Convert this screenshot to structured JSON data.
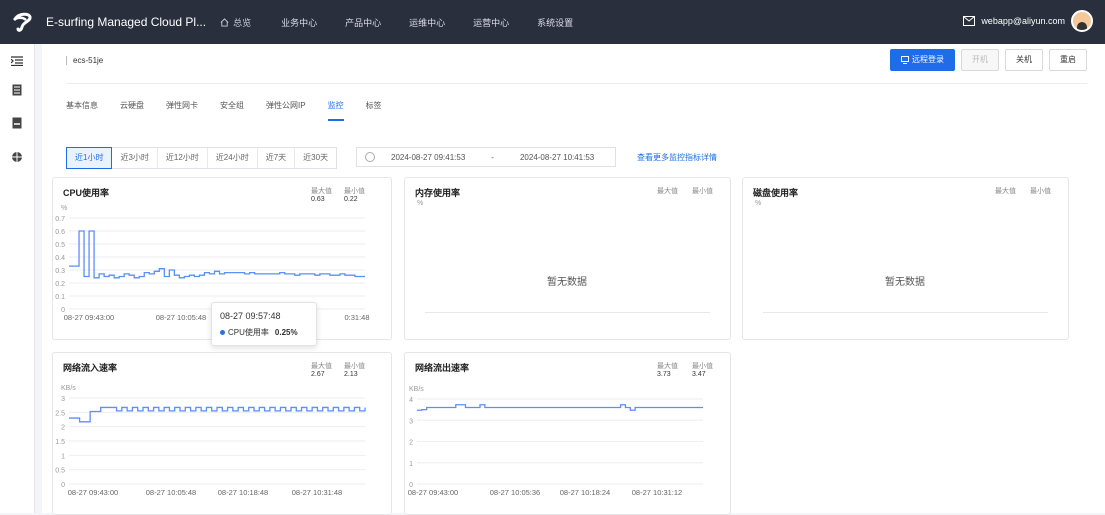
{
  "topbar": {
    "app_title": "E-surfing Managed Cloud Pl...",
    "home_label": "总览",
    "nav": [
      "业务中心",
      "产品中心",
      "运维中心",
      "运营中心",
      "系统设置"
    ],
    "user_email": "webapp@aliyun.com"
  },
  "instance": {
    "name": "ecs-51je",
    "actions": {
      "remote": "远程登录",
      "start": "开机",
      "stop": "关机",
      "restart": "重启"
    }
  },
  "tabs": [
    "基本信息",
    "云硬盘",
    "弹性网卡",
    "安全组",
    "弹性公网IP",
    "监控",
    "标签"
  ],
  "active_tab": "监控",
  "ranges": [
    "近1小时",
    "近3小时",
    "近12小时",
    "近24小时",
    "近7天",
    "近30天"
  ],
  "active_range": "近1小时",
  "time_start": "2024-08-27 09:41:53",
  "time_sep": "-",
  "time_end": "2024-08-27 10:41:53",
  "more_link": "查看更多监控指标详情",
  "labels": {
    "max": "最大值",
    "min": "最小值",
    "no_data": "暂无数据"
  },
  "cards": {
    "cpu": {
      "title": "CPU使用率",
      "unit": "%",
      "max": "0.63",
      "min": "0.22"
    },
    "mem": {
      "title": "内存使用率",
      "unit": "%"
    },
    "disk": {
      "title": "磁盘使用率",
      "unit": "%"
    },
    "net_in": {
      "title": "网络流入速率",
      "unit": "KB/s",
      "max": "2.67",
      "min": "2.13"
    },
    "net_out": {
      "title": "网络流出速率",
      "unit": "KB/s",
      "max": "3.73",
      "min": "3.47"
    }
  },
  "tooltip": {
    "time": "08-27 09:57:48",
    "series": "CPU使用率",
    "value": "0.25%"
  },
  "colors": {
    "accent": "#1e6ce8",
    "line": "#5b8ff9",
    "topbar": "#2a2f3d"
  },
  "chart_data": [
    {
      "type": "line",
      "title": "CPU使用率",
      "ylabel": "%",
      "ylim": [
        0,
        0.7
      ],
      "yticks": [
        "0",
        "0.1",
        "0.2",
        "0.3",
        "0.4",
        "0.5",
        "0.6",
        "0.7"
      ],
      "xticks": [
        "08-27 09:43:00",
        "08-27 10:05:48",
        "0:31:48"
      ],
      "x_index": [
        0,
        1,
        2,
        3,
        4,
        5,
        6,
        7,
        8,
        9,
        10,
        11,
        12,
        13,
        14,
        15,
        16,
        17,
        18,
        19,
        20,
        21,
        22,
        23,
        24,
        25,
        26,
        27,
        28,
        29,
        30,
        31,
        32,
        33,
        34,
        35,
        36,
        37,
        38,
        39,
        40,
        41,
        42,
        43,
        44,
        45,
        46,
        47,
        48,
        49,
        50,
        51,
        52,
        53,
        54,
        55,
        56,
        57,
        58,
        59
      ],
      "values": [
        0.33,
        0.33,
        0.6,
        0.25,
        0.6,
        0.24,
        0.27,
        0.25,
        0.26,
        0.24,
        0.25,
        0.27,
        0.26,
        0.24,
        0.25,
        0.28,
        0.27,
        0.29,
        0.31,
        0.25,
        0.3,
        0.26,
        0.24,
        0.25,
        0.26,
        0.25,
        0.26,
        0.28,
        0.27,
        0.29,
        0.27,
        0.28,
        0.28,
        0.28,
        0.28,
        0.27,
        0.28,
        0.27,
        0.27,
        0.27,
        0.27,
        0.27,
        0.28,
        0.27,
        0.27,
        0.26,
        0.27,
        0.27,
        0.27,
        0.26,
        0.27,
        0.27,
        0.26,
        0.26,
        0.27,
        0.26,
        0.26,
        0.25,
        0.25,
        0.25
      ],
      "grid": true
    },
    {
      "type": "line",
      "title": "网络流入速率",
      "ylabel": "KB/s",
      "ylim": [
        0,
        3
      ],
      "yticks": [
        "0",
        "0.5",
        "1",
        "1.5",
        "2",
        "2.5",
        "3"
      ],
      "xticks": [
        "08-27 09:43:00",
        "08-27 10:05:48",
        "08-27 10:18:48",
        "08-27 10:31:48"
      ],
      "values": [
        2.3,
        2.3,
        2.17,
        2.17,
        2.53,
        2.53,
        2.67,
        2.67,
        2.67,
        2.55,
        2.67,
        2.55,
        2.67,
        2.55,
        2.67,
        2.55,
        2.67,
        2.55,
        2.67,
        2.55,
        2.67,
        2.55,
        2.67,
        2.55,
        2.67,
        2.55,
        2.67,
        2.55,
        2.67,
        2.55,
        2.67,
        2.55,
        2.67,
        2.55,
        2.67,
        2.55,
        2.67,
        2.55,
        2.67,
        2.55,
        2.67,
        2.55,
        2.67,
        2.55,
        2.67,
        2.55,
        2.67,
        2.55,
        2.67,
        2.55,
        2.67,
        2.55,
        2.67,
        2.55,
        2.67,
        2.55,
        2.67
      ],
      "grid": true
    },
    {
      "type": "line",
      "title": "网络流出速率",
      "ylabel": "KB/s",
      "ylim": [
        0,
        4
      ],
      "yticks": [
        "0",
        "1",
        "2",
        "3",
        "4"
      ],
      "xticks": [
        "08-27 09:43:00",
        "08-27 10:05:36",
        "08-27 10:18:24",
        "08-27 10:31:12"
      ],
      "values": [
        3.47,
        3.5,
        3.6,
        3.6,
        3.6,
        3.6,
        3.6,
        3.6,
        3.73,
        3.73,
        3.6,
        3.6,
        3.6,
        3.73,
        3.6,
        3.6,
        3.6,
        3.6,
        3.6,
        3.6,
        3.6,
        3.6,
        3.6,
        3.6,
        3.6,
        3.6,
        3.6,
        3.6,
        3.6,
        3.6,
        3.6,
        3.6,
        3.6,
        3.6,
        3.6,
        3.6,
        3.6,
        3.6,
        3.6,
        3.6,
        3.6,
        3.6,
        3.73,
        3.6,
        3.47,
        3.6,
        3.6,
        3.6,
        3.6,
        3.6,
        3.6,
        3.6,
        3.6,
        3.6,
        3.6,
        3.6,
        3.6,
        3.6,
        3.6,
        3.6
      ],
      "grid": true
    }
  ]
}
